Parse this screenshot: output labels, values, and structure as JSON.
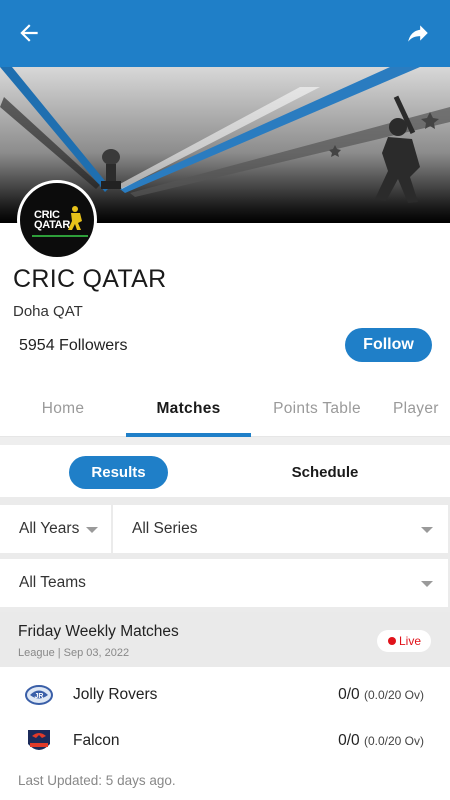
{
  "header": {
    "back_icon": "arrow-left-icon",
    "share_icon": "share-icon",
    "accent": "#1f7fc8"
  },
  "club": {
    "logo_line1": "CRIC",
    "logo_line2": "QATAR",
    "name": "CRIC QATAR",
    "city": "Doha QAT",
    "followers": "5954 Followers",
    "follow_label": "Follow"
  },
  "tabs": [
    {
      "label": "Home"
    },
    {
      "label": "Matches",
      "active": true
    },
    {
      "label": "Points Table"
    },
    {
      "label": "Player"
    }
  ],
  "subtabs": {
    "results_label": "Results",
    "schedule_label": "Schedule"
  },
  "filters": {
    "years": "All Years",
    "series": "All Series",
    "teams": "All Teams"
  },
  "match": {
    "title": "Friday Weekly Matches",
    "subtitle": "League | Sep 03, 2022",
    "status": "Live",
    "teams": [
      {
        "name": "Jolly Rovers",
        "score": "0/0",
        "overs": "(0.0/20 Ov)"
      },
      {
        "name": "Falcon",
        "score": "0/0",
        "overs": "(0.0/20 Ov)"
      }
    ],
    "updated": "Last Updated: 5 days ago."
  }
}
